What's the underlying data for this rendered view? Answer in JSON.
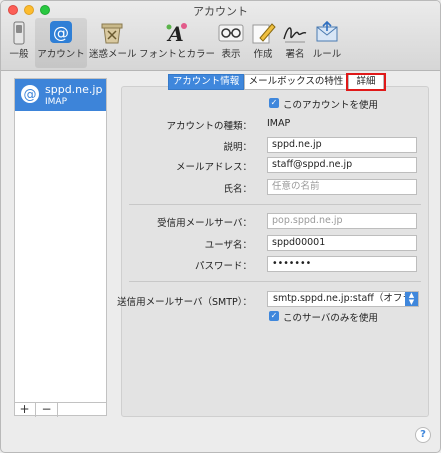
{
  "window": {
    "title": "アカウント"
  },
  "toolbar": {
    "items": [
      {
        "label": "一般",
        "icon": "switch-icon"
      },
      {
        "label": "アカウント",
        "icon": "at-icon"
      },
      {
        "label": "迷惑メール",
        "icon": "junk-icon"
      },
      {
        "label": "フォントとカラー",
        "icon": "font-icon"
      },
      {
        "label": "表示",
        "icon": "glasses-icon"
      },
      {
        "label": "作成",
        "icon": "pencil-icon"
      },
      {
        "label": "署名",
        "icon": "signature-icon"
      },
      {
        "label": "ルール",
        "icon": "rules-icon"
      }
    ],
    "selected": "アカウント"
  },
  "sidebar": {
    "accounts": [
      {
        "name": "sppd.ne.jp",
        "type": "IMAP"
      }
    ],
    "add_label": "+",
    "remove_label": "−"
  },
  "tabs": [
    {
      "label": "アカウント情報",
      "active": true
    },
    {
      "label": "メールボックスの特性",
      "active": false
    },
    {
      "label": "詳細",
      "active": false
    }
  ],
  "form": {
    "enable_label": "このアカウントを使用",
    "account_type_label": "アカウントの種類：",
    "account_type_value": "IMAP",
    "description_label": "説明：",
    "description_value": "sppd.ne.jp",
    "email_label": "メールアドレス：",
    "email_value": "staff@sppd.ne.jp",
    "fullname_label": "氏名：",
    "fullname_placeholder": "任意の名前",
    "incoming_label": "受信用メールサーバ：",
    "incoming_placeholder": "pop.sppd.ne.jp",
    "username_label": "ユーザ名：",
    "username_value": "sppd00001",
    "password_label": "パスワード：",
    "password_value": "•••••••",
    "smtp_label": "送信用メールサーバ（SMTP）：",
    "smtp_value": "smtp.sppd.ne.jp:staff（オフライン）",
    "only_server_label": "このサーバのみを使用"
  },
  "colors": {
    "accent": "#3f87dc",
    "highlight": "#e01919"
  },
  "help_label": "?"
}
